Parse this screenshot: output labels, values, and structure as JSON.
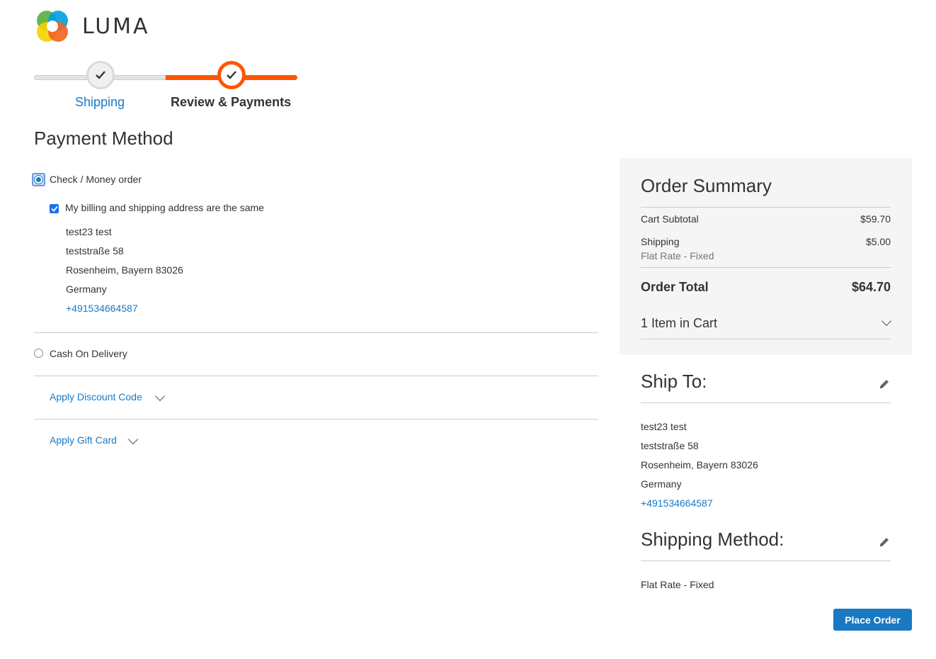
{
  "brand": {
    "name": "LUMA"
  },
  "progress": {
    "steps": [
      {
        "label": "Shipping",
        "state": "complete"
      },
      {
        "label": "Review & Payments",
        "state": "active"
      }
    ]
  },
  "payment": {
    "title": "Payment Method",
    "methods": [
      {
        "label": "Check / Money order",
        "selected": true
      },
      {
        "label": "Cash On Delivery",
        "selected": false
      }
    ],
    "billing_same_label": "My billing and shipping address are the same",
    "billing_same_checked": true,
    "address": {
      "name": "test23 test",
      "street": "teststraße 58",
      "city_line": "Rosenheim, Bayern 83026",
      "country": "Germany",
      "phone": "+491534664587"
    },
    "discount_label": "Apply Discount Code",
    "giftcard_label": "Apply Gift Card"
  },
  "summary": {
    "title": "Order Summary",
    "subtotal_label": "Cart Subtotal",
    "subtotal_value": "$59.70",
    "shipping_label": "Shipping",
    "shipping_value": "$5.00",
    "shipping_method": "Flat Rate - Fixed",
    "total_label": "Order Total",
    "total_value": "$64.70",
    "items_label": "1 Item in Cart"
  },
  "ship_to": {
    "title": "Ship To:",
    "name": "test23 test",
    "street": "teststraße 58",
    "city_line": "Rosenheim, Bayern 83026",
    "country": "Germany",
    "phone": "+491534664587"
  },
  "shipping_method": {
    "title": "Shipping Method:",
    "value": "Flat Rate - Fixed"
  },
  "actions": {
    "place_order": "Place Order"
  },
  "colors": {
    "accent": "#1979c3",
    "progress": "#ff5501"
  }
}
